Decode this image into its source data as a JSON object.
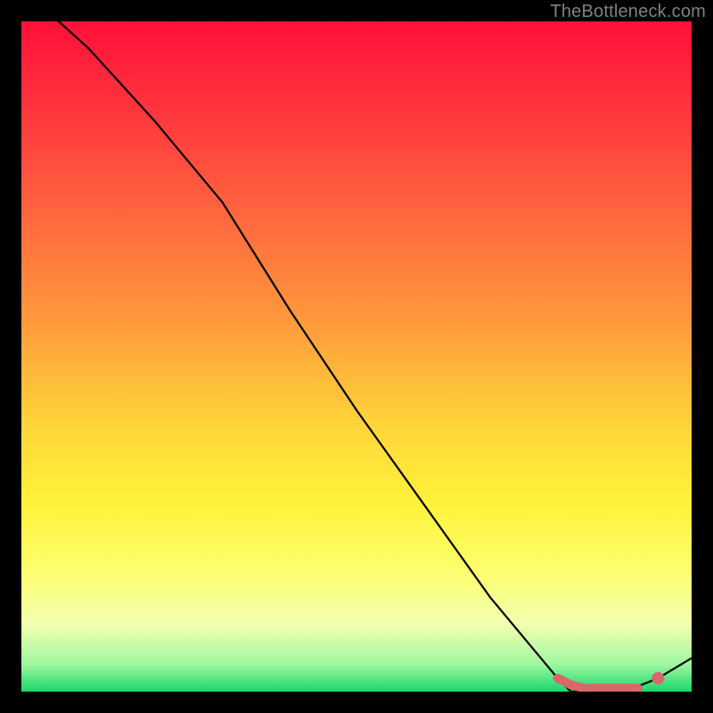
{
  "watermark": "TheBottleneck.com",
  "chart_data": {
    "type": "line",
    "title": "",
    "xlabel": "",
    "ylabel": "",
    "xlim": [
      0,
      100
    ],
    "ylim": [
      0,
      100
    ],
    "grid": false,
    "legend": false,
    "series": [
      {
        "name": "curve",
        "color": "#000000",
        "x": [
          0,
          10,
          20,
          30,
          40,
          50,
          60,
          70,
          80,
          82,
          85,
          88,
          90,
          95,
          100
        ],
        "y": [
          105,
          96,
          85,
          73,
          57,
          42,
          28,
          14,
          2,
          0,
          0,
          0,
          0,
          2,
          5
        ]
      }
    ],
    "markers": [
      {
        "name": "flat-segment",
        "color": "#d9666a",
        "style": "thick-rounded",
        "x": [
          80,
          82,
          84,
          86,
          88,
          90,
          92
        ],
        "y": [
          2,
          1,
          0.5,
          0.5,
          0.5,
          0.5,
          0.5
        ]
      },
      {
        "name": "end-dot",
        "color": "#d9666a",
        "style": "dot",
        "x": 95,
        "y": 2
      }
    ],
    "background_gradient": {
      "stops": [
        {
          "pos": 0.0,
          "color": "#ff1039"
        },
        {
          "pos": 0.15,
          "color": "#ff3a3e"
        },
        {
          "pos": 0.3,
          "color": "#ff6a3e"
        },
        {
          "pos": 0.45,
          "color": "#ff9a3c"
        },
        {
          "pos": 0.6,
          "color": "#ffd43a"
        },
        {
          "pos": 0.72,
          "color": "#fff23a"
        },
        {
          "pos": 0.82,
          "color": "#fdff6e"
        },
        {
          "pos": 0.9,
          "color": "#f1ffb0"
        },
        {
          "pos": 0.96,
          "color": "#9ef7a0"
        },
        {
          "pos": 1.0,
          "color": "#16d76a"
        }
      ]
    }
  }
}
